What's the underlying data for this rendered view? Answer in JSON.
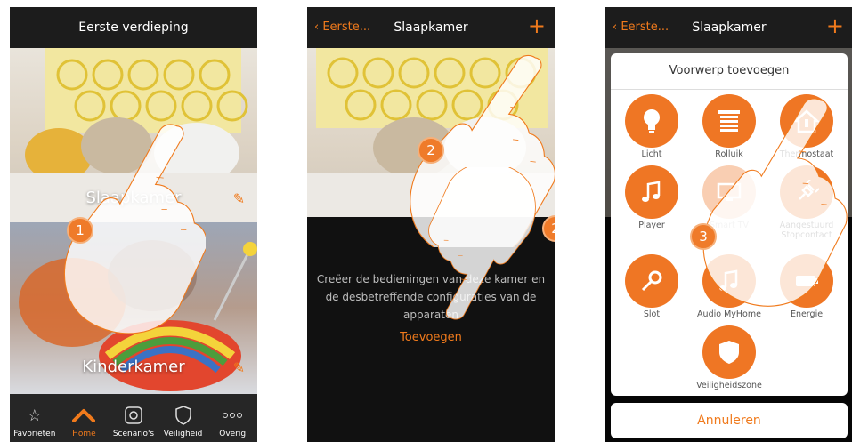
{
  "phone1": {
    "title": "Eerste verdieping",
    "rooms": [
      {
        "name": "Slaapkamer"
      },
      {
        "name": "Kinderkamer"
      }
    ],
    "tabs": [
      {
        "label": "Favorieten",
        "icon": "star-icon"
      },
      {
        "label": "Home",
        "icon": "home-icon"
      },
      {
        "label": "Scenario's",
        "icon": "scenario-icon"
      },
      {
        "label": "Veiligheid",
        "icon": "shield-icon"
      },
      {
        "label": "Overig",
        "icon": "more-icon"
      }
    ],
    "active_tab": "Home",
    "step": "1"
  },
  "phone2": {
    "back_label": "Eerste...",
    "title": "Slaapkamer",
    "add_icon": "+",
    "empty_text": "Creëer de bedieningen van deze kamer en de desbetreffende configuraties van de apparaten",
    "add_link": "Toevoegen",
    "step_a": "2",
    "step_b": "2"
  },
  "phone3": {
    "back_label": "Eerste...",
    "title": "Slaapkamer",
    "add_icon": "+",
    "dialog_title": "Voorwerp toevoegen",
    "objects": [
      {
        "label": "Licht",
        "icon": "bulb-icon"
      },
      {
        "label": "Rolluik",
        "icon": "shutter-icon"
      },
      {
        "label": "Thermostaat",
        "icon": "thermostat-icon"
      },
      {
        "label": "Player",
        "icon": "music-note-icon"
      },
      {
        "label": "Smart TV",
        "icon": "tv-icon"
      },
      {
        "label": "Aangestuurd Stopcontact",
        "icon": "plug-icon"
      },
      {
        "label": "Slot",
        "icon": "key-icon"
      },
      {
        "label": "Audio MyHome",
        "icon": "music-note-icon"
      },
      {
        "label": "Energie",
        "icon": "battery-icon"
      },
      {
        "label": "Veiligheidszone",
        "icon": "shield-icon"
      }
    ],
    "cancel_label": "Annuleren",
    "step": "3"
  },
  "colors": {
    "accent": "#f07a1c",
    "header": "#1c1c1c",
    "tabbar": "#262626"
  }
}
